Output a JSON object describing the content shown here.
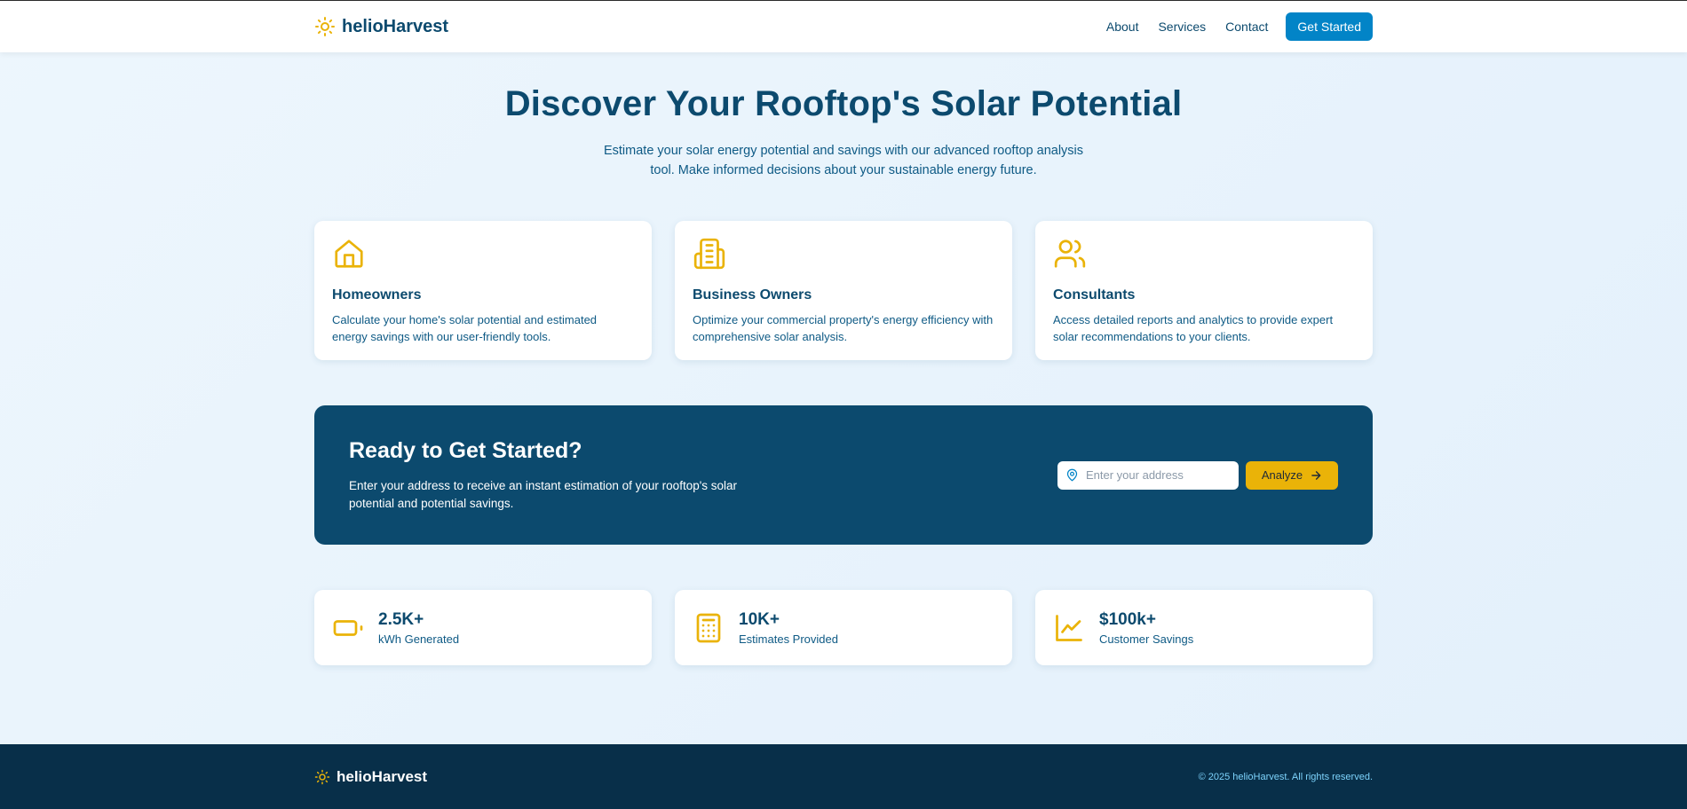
{
  "header": {
    "brand": "helioHarvest",
    "brand_icon": "sun-icon",
    "nav": [
      "About",
      "Services",
      "Contact"
    ],
    "cta": "Get Started"
  },
  "hero": {
    "title": "Discover Your Rooftop's Solar Potential",
    "subtitle": "Estimate your solar energy potential and savings with our advanced rooftop analysis tool. Make informed decisions about your sustainable energy future."
  },
  "features": [
    {
      "icon": "house-icon",
      "title": "Homeowners",
      "desc": "Calculate your home's solar potential and estimated energy savings with our user-friendly tools."
    },
    {
      "icon": "building-icon",
      "title": "Business Owners",
      "desc": "Optimize your commercial property's energy efficiency with comprehensive solar analysis."
    },
    {
      "icon": "users-icon",
      "title": "Consultants",
      "desc": "Access detailed reports and analytics to provide expert solar recommendations to your clients."
    }
  ],
  "banner": {
    "title": "Ready to Get Started?",
    "desc": "Enter your address to receive an instant estimation of your rooftop's solar potential and potential savings.",
    "input_placeholder": "Enter your address",
    "input_value": "",
    "button": "Analyze"
  },
  "stats": [
    {
      "icon": "battery-icon",
      "value": "2.5K+",
      "label": "kWh Generated"
    },
    {
      "icon": "calculator-icon",
      "value": "10K+",
      "label": "Estimates Provided"
    },
    {
      "icon": "trending-up-icon",
      "value": "$100k+",
      "label": "Customer Savings"
    }
  ],
  "footer": {
    "brand": "helioHarvest",
    "copyright": "© 2025 helioHarvest. All rights reserved."
  },
  "colors": {
    "primary": "#0c4a6e",
    "accent": "#eab308",
    "button_blue": "#0284c7",
    "footer_bg": "#082f49",
    "footer_text": "#7dd3fc"
  }
}
